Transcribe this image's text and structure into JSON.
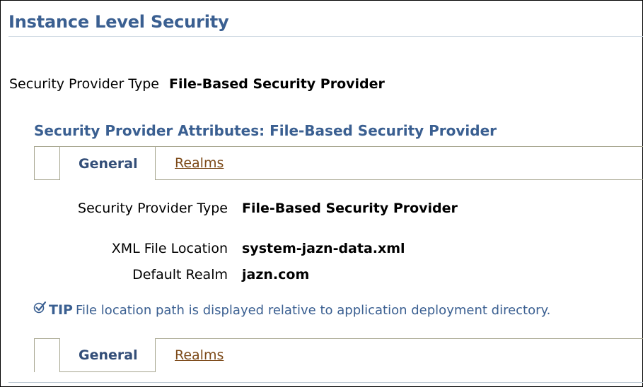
{
  "page": {
    "title": "Instance Level Security"
  },
  "provider": {
    "label": "Security Provider Type",
    "value": "File-Based Security Provider"
  },
  "section": {
    "title": "Security Provider Attributes: File-Based Security Provider"
  },
  "tabs": {
    "general_label": "General",
    "realms_label": "Realms"
  },
  "attributes": {
    "provider_type": {
      "label": "Security Provider Type",
      "value": "File-Based Security Provider"
    },
    "xml_file_location": {
      "label": "XML File Location",
      "value": "system-jazn-data.xml"
    },
    "default_realm": {
      "label": "Default Realm",
      "value": "jazn.com"
    }
  },
  "tip": {
    "label": "TIP",
    "text": "File location path is displayed relative to application deployment directory.",
    "icon": "checkmark-tip-icon"
  },
  "colors": {
    "heading_blue": "#3a5f91",
    "link_brown": "#7d4a19",
    "tab_border": "#a6a58e"
  }
}
